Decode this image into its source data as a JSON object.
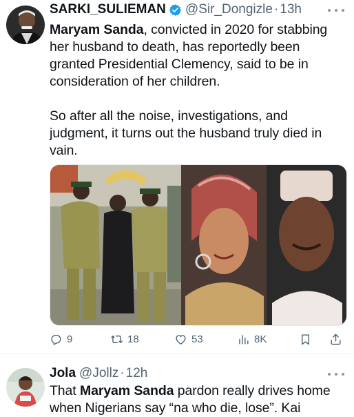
{
  "tweets": [
    {
      "name": "SARKI_SULIEMAN",
      "handle": "@Sir_Dongizle",
      "dot": "·",
      "time": "13h",
      "text": {
        "bold_lead": "Maryam Sanda",
        "line1_rest": ", convicted in 2020 for stabbing",
        "line2": "her husband to death, has reportedly been",
        "line3": "granted Presidential Clemency, said to be in",
        "line4": "consideration of her children.",
        "line5": "So after all the noise, investigations, and",
        "line6": "judgment, it turns out the husband truly died in",
        "line7": "vain."
      },
      "stats": {
        "replies": "9",
        "retweets": "18",
        "likes": "53",
        "views": "8K"
      }
    },
    {
      "name": "Jola",
      "handle": "@Jollz",
      "dot": "·",
      "time": "12h",
      "text": {
        "lead": "That ",
        "bold": "Maryam Sanda",
        "rest": " pardon really drives home",
        "line2": "when Nigerians say “na who die, lose”. Kai"
      }
    }
  ],
  "colors": {
    "text": "#0f1419",
    "secondary": "#536471",
    "verified": "#1d9bf0",
    "divider": "#eff3f4"
  },
  "icons": [
    "verified-badge-icon",
    "more-icon",
    "reply-icon",
    "retweet-icon",
    "like-icon",
    "views-icon",
    "bookmark-icon",
    "share-icon"
  ]
}
